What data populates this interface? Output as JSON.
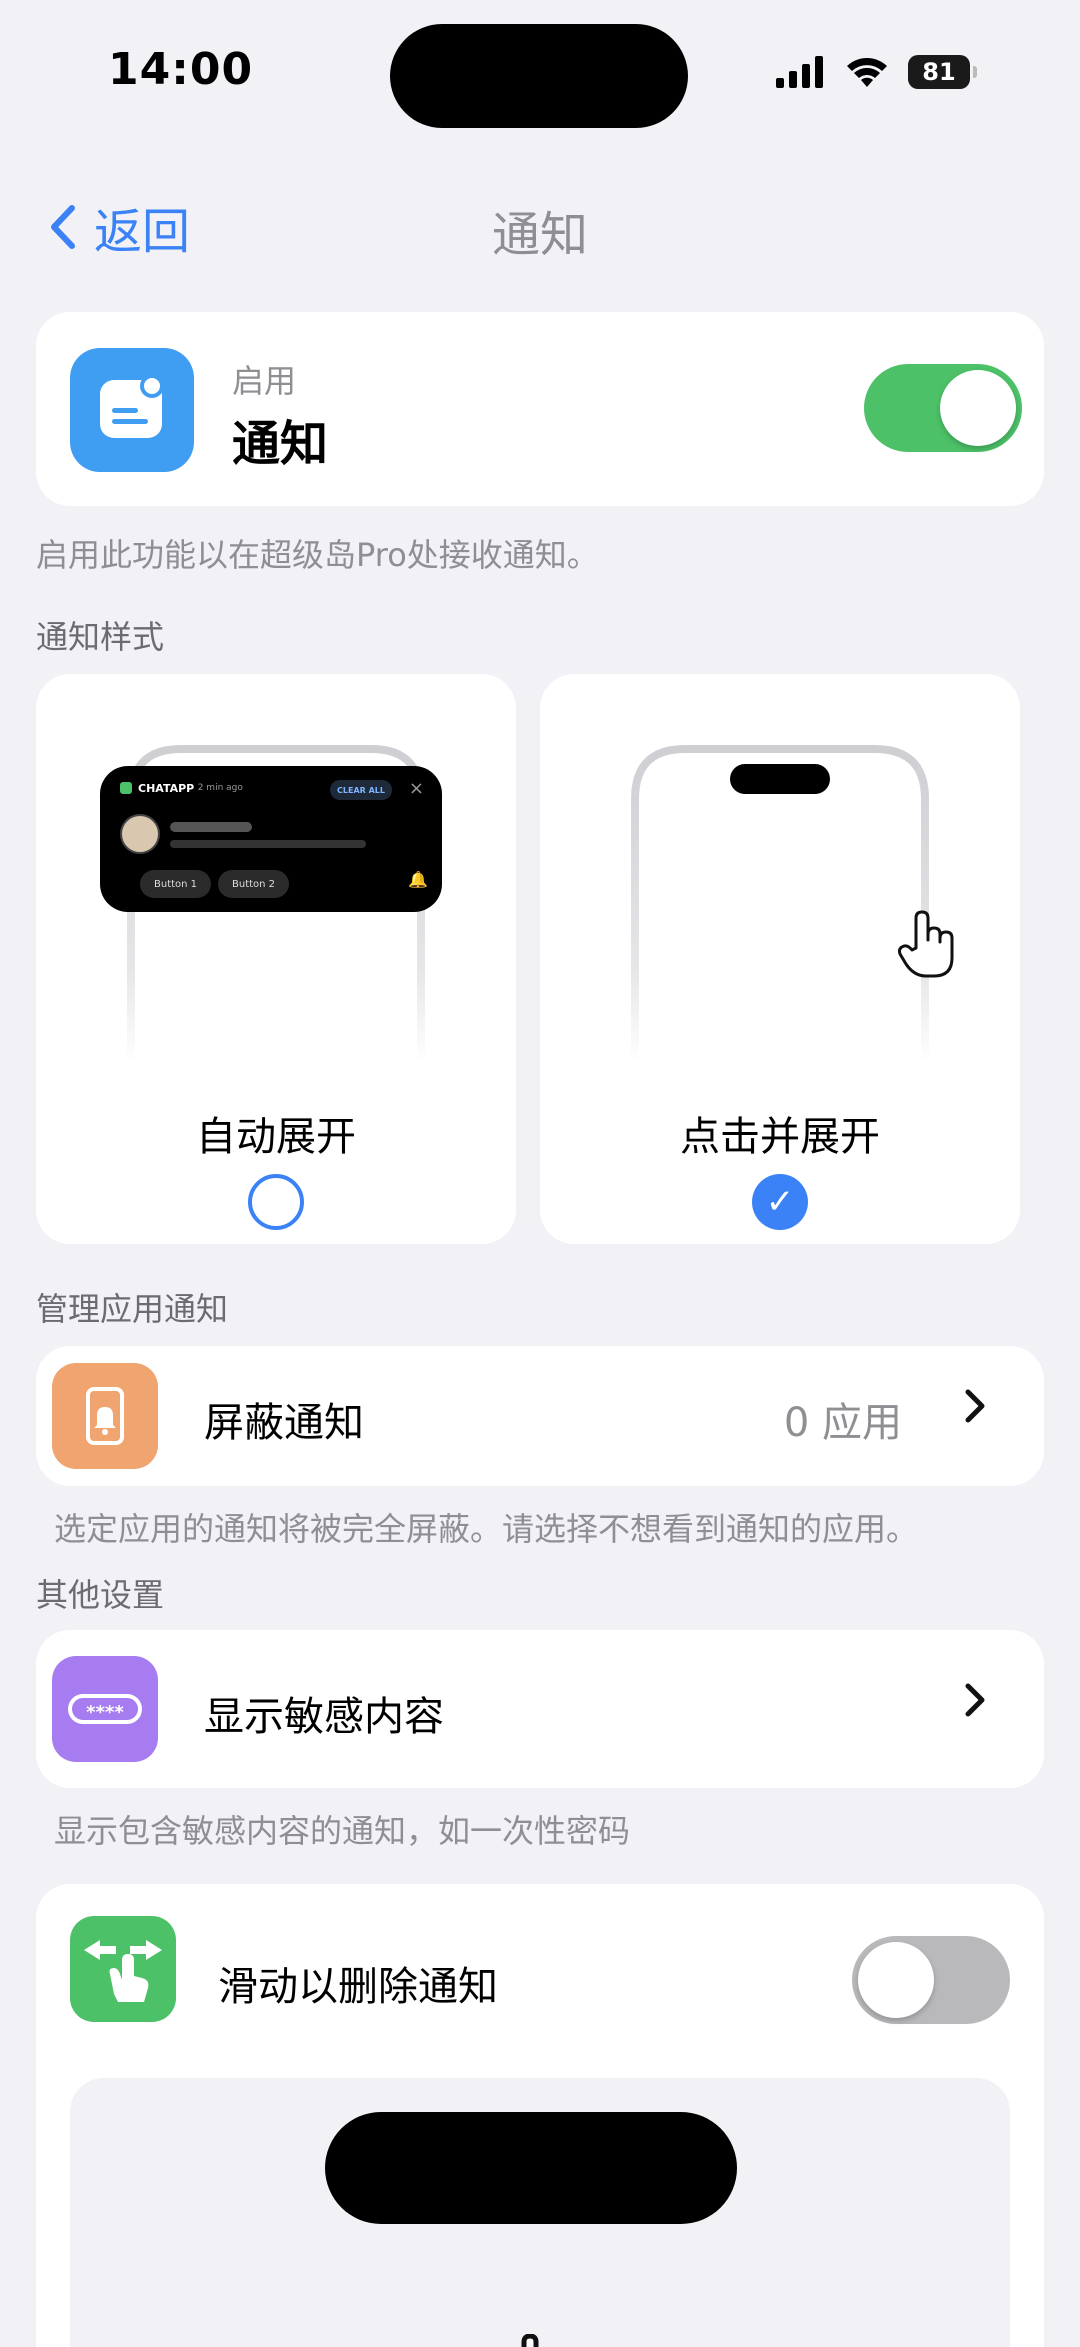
{
  "status": {
    "time": "14:00",
    "battery": "81"
  },
  "nav": {
    "back_label": "返回",
    "title": "通知"
  },
  "enable": {
    "subtitle": "启用",
    "title": "通知",
    "enabled": true,
    "hint": "启用此功能以在超级岛Pro处接收通知。"
  },
  "style_section": {
    "label": "通知样式",
    "options": [
      {
        "label": "自动展开",
        "selected": false
      },
      {
        "label": "点击并展开",
        "selected": true
      }
    ],
    "preview": {
      "app_name": "CHATAPP",
      "ago": "· 2 min ago",
      "clear": "CLEAR ALL",
      "button1": "Button 1",
      "button2": "Button 2"
    }
  },
  "manage_section": {
    "label": "管理应用通知",
    "block": {
      "title": "屏蔽通知",
      "value": "0 应用",
      "hint": "选定应用的通知将被完全屏蔽。请选择不想看到通知的应用。"
    }
  },
  "other_section": {
    "label": "其他设置",
    "sensitive": {
      "title": "显示敏感内容",
      "hint": "显示包含敏感内容的通知，如一次性密码",
      "icon_text": "****"
    },
    "swipe": {
      "title": "滑动以删除通知",
      "enabled": false
    }
  },
  "colors": {
    "accent": "#3b82f6",
    "toggle_on": "#4cc168",
    "block_icon": "#f0a470",
    "sensitive_icon": "#a67cf0",
    "swipe_icon": "#4cc168"
  }
}
